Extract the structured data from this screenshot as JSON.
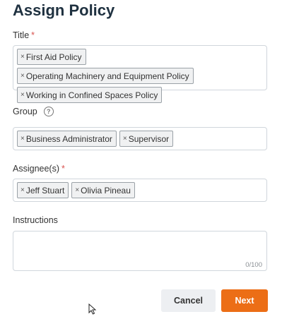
{
  "dialog": {
    "title": "Assign Policy"
  },
  "fields": {
    "title": {
      "label": "Title",
      "required_mark": "*",
      "chips": [
        "First Aid Policy",
        "Operating Machinery and Equipment Policy",
        "Working in Confined Spaces Policy"
      ]
    },
    "group": {
      "label": "Group",
      "help_glyph": "?",
      "chips": [
        "Business Administrator",
        "Supervisor"
      ]
    },
    "assignees": {
      "label": "Assignee(s)",
      "required_mark": "*",
      "chips": [
        "Jeff Stuart",
        "Olivia Pineau"
      ]
    },
    "instructions": {
      "label": "Instructions",
      "value": "",
      "counter": "0/100"
    }
  },
  "chip_remove_glyph": "×",
  "buttons": {
    "cancel": "Cancel",
    "next": "Next"
  },
  "colors": {
    "title": "#1f3140",
    "primary": "#ec6e16",
    "required": "#d9534f"
  }
}
